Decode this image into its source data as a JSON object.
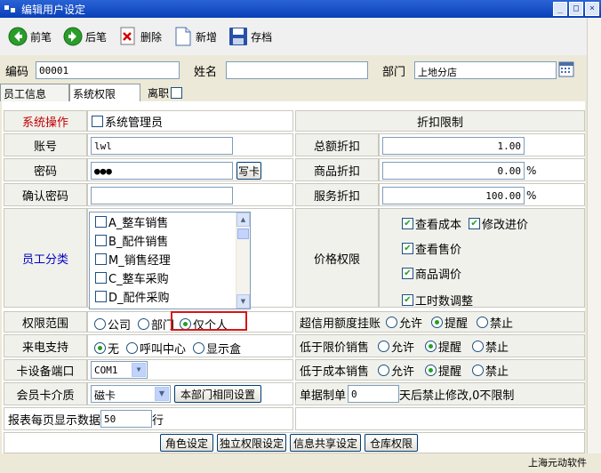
{
  "window": {
    "title": "编辑用户设定"
  },
  "toolbar": {
    "prev": "前笔",
    "next": "后笔",
    "delete": "删除",
    "add": "新增",
    "save": "存档"
  },
  "header": {
    "code_label": "编码",
    "code_value": "00001",
    "name_label": "姓名",
    "name_value": "",
    "dept_label": "部门",
    "dept_value": "上地分店"
  },
  "tabs": {
    "staff_info": "员工信息",
    "sys_perm": "系统权限",
    "resigned": "离职"
  },
  "form": {
    "sys_op": "系统操作",
    "sys_admin": "系统管理员",
    "account_label": "账号",
    "account_value": "lwl",
    "password_label": "密码",
    "password_value": "●●●",
    "write_card": "写卡",
    "confirm_label": "确认密码",
    "confirm_value": "",
    "discount_title": "折扣限制",
    "total_discount": "总额折扣",
    "total_discount_value": "1.00",
    "goods_discount": "商品折扣",
    "goods_discount_value": "0.00",
    "service_discount": "服务折扣",
    "service_discount_value": "100.00",
    "percent": "%",
    "staff_category": "员工分类",
    "categories": [
      "A_整车销售",
      "B_配件销售",
      "M_销售经理",
      "C_整车采购",
      "D_配件采购"
    ],
    "price_perm": "价格权限",
    "view_cost": "查看成本",
    "modify_purchase": "修改进价",
    "view_sale": "查看售价",
    "goods_adjust": "商品调价",
    "labor_adjust": "工时数调整",
    "scope_label": "权限范围",
    "scope_company": "公司",
    "scope_dept": "部门",
    "scope_self": "仅个人",
    "credit_label": "超信用额度挂账",
    "allow": "允许",
    "remind": "提醒",
    "forbid": "禁止",
    "call_label": "来电支持",
    "call_none": "无",
    "call_center": "呼叫中心",
    "call_box": "显示盒",
    "below_limit": "低于限价销售",
    "card_port_label": "卡设备端口",
    "card_port_value": "COM1",
    "below_cost": "低于成本销售",
    "member_card_label": "会员卡介质",
    "member_card_value": "磁卡",
    "dept_same_setting": "本部门相同设置",
    "doc_label": "单据制单",
    "doc_days": "0",
    "doc_suffix": "天后禁止修改,0不限制",
    "report_label": "报表每页显示数据",
    "report_value": "50",
    "report_unit": "行",
    "role_setting": "角色设定",
    "independent_perm": "独立权限设定",
    "info_share": "信息共享设定",
    "warehouse_perm": "仓库权限"
  },
  "footer": {
    "company": "上海元动软件"
  }
}
